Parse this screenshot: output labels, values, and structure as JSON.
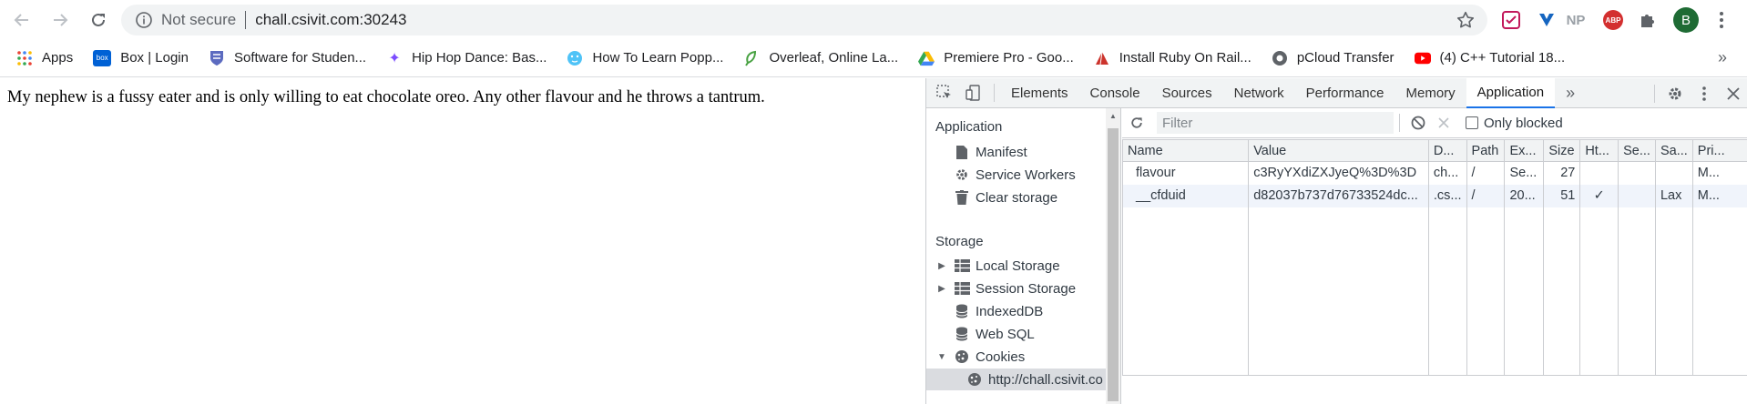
{
  "toolbar": {
    "security_label": "Not secure",
    "url": "chall.csivit.com:30243",
    "extensions": [
      "NP",
      "ABP"
    ],
    "avatar_letter": "B"
  },
  "bookmarks": [
    {
      "label": "Apps",
      "icon": "apps-grid-icon"
    },
    {
      "label": "Box | Login",
      "icon": "box-icon"
    },
    {
      "label": "Software for Studen...",
      "icon": "crest-icon"
    },
    {
      "label": "Hip Hop Dance: Bas...",
      "icon": "sparkle-icon"
    },
    {
      "label": "How To Learn Popp...",
      "icon": "face-icon"
    },
    {
      "label": "Overleaf, Online La...",
      "icon": "leaf-icon"
    },
    {
      "label": "Premiere Pro - Goo...",
      "icon": "drive-icon"
    },
    {
      "label": "Install Ruby On Rail...",
      "icon": "ruby-icon"
    },
    {
      "label": "pCloud Transfer",
      "icon": "pcloud-icon"
    },
    {
      "label": "(4) C++ Tutorial 18...",
      "icon": "youtube-icon"
    }
  ],
  "page": {
    "text": "My nephew is a fussy eater and is only willing to eat chocolate oreo. Any other flavour and he throws a tantrum."
  },
  "devtools": {
    "tabs": [
      "Elements",
      "Console",
      "Sources",
      "Network",
      "Performance",
      "Memory",
      "Application"
    ],
    "active_tab": "Application",
    "sidebar": {
      "app_header": "Application",
      "app_items": [
        "Manifest",
        "Service Workers",
        "Clear storage"
      ],
      "storage_header": "Storage",
      "storage_items": [
        "Local Storage",
        "Session Storage",
        "IndexedDB",
        "Web SQL",
        "Cookies"
      ],
      "cookie_origin": "http://chall.csivit.co"
    },
    "filter": {
      "placeholder": "Filter",
      "only_blocked_label": "Only blocked"
    },
    "cookies": {
      "columns": [
        "Name",
        "Value",
        "D...",
        "Path",
        "Ex...",
        "Size",
        "Ht...",
        "Se...",
        "Sa...",
        "Pri..."
      ],
      "rows": [
        [
          "flavour",
          "c3RyYXdiZXJyeQ%3D%3D",
          "ch...",
          "/",
          "Se...",
          "27",
          "",
          "",
          "",
          "M..."
        ],
        [
          "__cfduid",
          "d82037b737d76733524dc...",
          ".cs...",
          "/",
          "20...",
          "51",
          "✓",
          "",
          "Lax",
          "M..."
        ]
      ]
    }
  }
}
